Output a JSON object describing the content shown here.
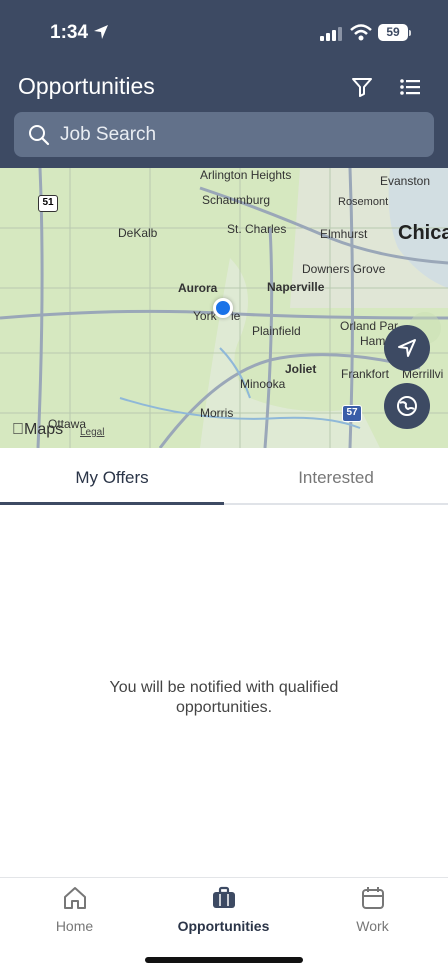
{
  "status_bar": {
    "time": "1:34",
    "battery": "59"
  },
  "header": {
    "title": "Opportunities"
  },
  "search": {
    "placeholder": "Job Search"
  },
  "map": {
    "cities": {
      "arlington_heights": "Arlington Heights",
      "evanston": "Evanston",
      "schaumburg": "Schaumburg",
      "rosemont": "Rosemont",
      "dekalb": "DeKalb",
      "st_charles": "St. Charles",
      "elmhurst": "Elmhurst",
      "chicago": "Chica",
      "downers_grove": "Downers Grove",
      "aurora": "Aurora",
      "naperville": "Naperville",
      "yorkville": "York",
      "yorkville_tail": "ie",
      "plainfield": "Plainfield",
      "orland_park": "Orland Par",
      "hammond_partial": "Ham",
      "joliet": "Joliet",
      "frankfort": "Frankfort",
      "merrillville": "Merrillvi",
      "minooka": "Minooka",
      "morris": "Morris",
      "ottawa": "Ottawa"
    },
    "shields": {
      "i51": "51",
      "i57": "57"
    },
    "attribution": {
      "maps": "Maps",
      "legal": "Legal"
    }
  },
  "tabs": [
    {
      "label": "My Offers",
      "active": true
    },
    {
      "label": "Interested",
      "active": false
    }
  ],
  "empty_state": {
    "message": "You will be notified with qualified opportunities."
  },
  "bottom_nav": [
    {
      "label": "Home",
      "icon": "home-icon"
    },
    {
      "label": "Opportunities",
      "icon": "briefcase-icon",
      "active": true
    },
    {
      "label": "Work",
      "icon": "calendar-icon"
    }
  ],
  "colors": {
    "header": "#3d4a63",
    "accent": "#1a73e8",
    "map_land": "#d6e8c0",
    "lake": "#a8cde8"
  }
}
